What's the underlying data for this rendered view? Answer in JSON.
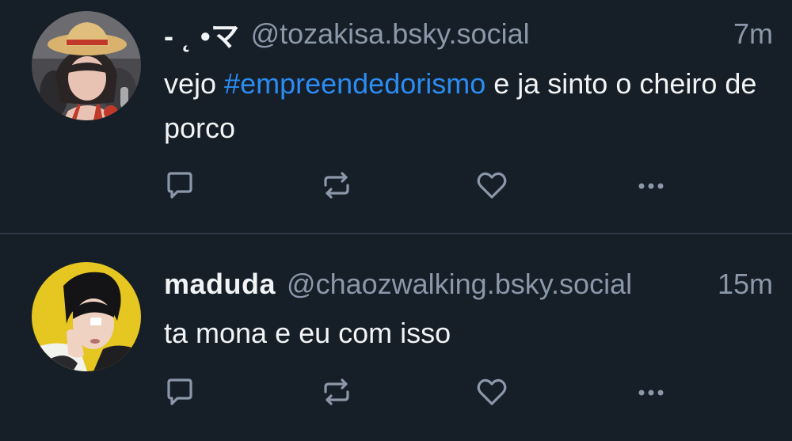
{
  "colors": {
    "background": "#161e27",
    "divider": "#2e3a48",
    "text": "#f1f3f5",
    "muted": "#8b98a9",
    "hashtag": "#2b8cf2"
  },
  "posts": [
    {
      "display_name": "- ˛ •マ",
      "handle": "@tozakisa.bsky.social",
      "time": "7m",
      "text_before": "vejo ",
      "hashtag": "#empreendedorismo",
      "text_after": " e ja sinto o cheiro de porco",
      "avatar": "avatar-icon-straw-hat-girl",
      "actions": [
        "reply-icon",
        "repost-icon",
        "like-icon",
        "more-icon"
      ]
    },
    {
      "display_name": "maduda",
      "handle": "@chaozwalking.bsky.social",
      "time": "15m",
      "text": "ta mona e eu com isso",
      "avatar": "avatar-icon-dark-haired-person",
      "actions": [
        "reply-icon",
        "repost-icon",
        "like-icon",
        "more-icon"
      ]
    }
  ]
}
